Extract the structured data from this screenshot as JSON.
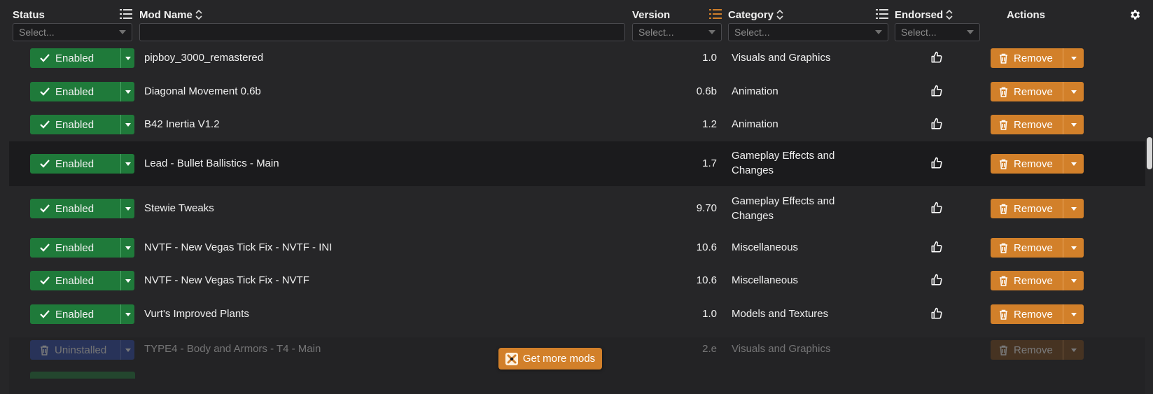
{
  "header": {
    "status_label": "Status",
    "status_placeholder": "Select...",
    "mod_name_label": "Mod Name",
    "mod_name_filter_value": "",
    "version_label": "Version",
    "version_placeholder": "Select...",
    "category_label": "Category",
    "category_placeholder": "Select...",
    "endorsed_label": "Endorsed",
    "endorsed_placeholder": "Select...",
    "actions_label": "Actions"
  },
  "rows": [
    {
      "status": "Enabled",
      "name": "pipboy_3000_remastered",
      "version": "1.0",
      "category": "Visuals and Graphics",
      "action": "Remove"
    },
    {
      "status": "Enabled",
      "name": "Diagonal Movement 0.6b",
      "version": "0.6b",
      "category": "Animation",
      "action": "Remove"
    },
    {
      "status": "Enabled",
      "name": "B42 Inertia V1.2",
      "version": "1.2",
      "category": "Animation",
      "action": "Remove"
    },
    {
      "status": "Enabled",
      "name": "Lead - Bullet Ballistics - Main",
      "version": "1.7",
      "category": "Gameplay Effects and Changes",
      "action": "Remove"
    },
    {
      "status": "Enabled",
      "name": "Stewie Tweaks",
      "version": "9.70",
      "category": "Gameplay Effects and Changes",
      "action": "Remove"
    },
    {
      "status": "Enabled",
      "name": "NVTF - New Vegas Tick Fix - NVTF - INI",
      "version": "10.6",
      "category": "Miscellaneous",
      "action": "Remove"
    },
    {
      "status": "Enabled",
      "name": "NVTF - New Vegas Tick Fix - NVTF",
      "version": "10.6",
      "category": "Miscellaneous",
      "action": "Remove"
    },
    {
      "status": "Enabled",
      "name": "Vurt's Improved Plants",
      "version": "1.0",
      "category": "Models and Textures",
      "action": "Remove"
    },
    {
      "status": "Uninstalled",
      "name": "TYPE4 - Body and Armors - T4 - Main",
      "version": "2.e",
      "category": "Visuals and Graphics",
      "action": "Remove"
    }
  ],
  "get_more_mods_label": "Get more mods",
  "colors": {
    "background": "#262628",
    "enabled_green": "#1f7a3a",
    "uninstalled_blue": "#2d4aa8",
    "accent_orange": "#d2802a",
    "active_list_icon": "#d2802a"
  },
  "icons": {
    "status_enabled": "check-icon",
    "status_uninstalled": "trash-icon",
    "endorse": "thumbs-up-icon",
    "remove": "trash-icon",
    "settings": "gear-icon",
    "group": "list-icon",
    "sort": "sort-icon"
  }
}
